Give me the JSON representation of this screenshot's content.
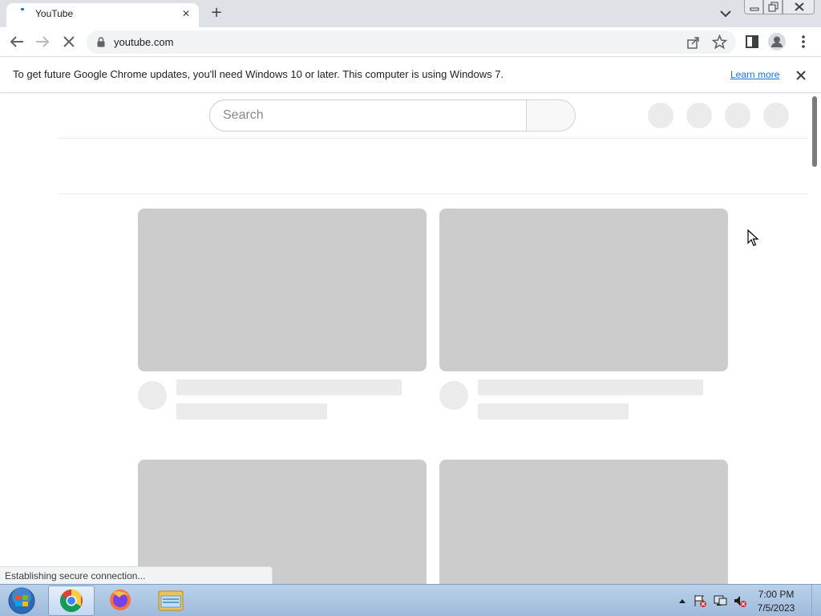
{
  "browser": {
    "tab_title": "YouTube",
    "address": "youtube.com",
    "colors": {
      "tab_strip": "#dee1e6",
      "omnibox": "#f1f3f4",
      "link": "#1a73e8"
    }
  },
  "infobar": {
    "message": "To get future Google Chrome updates, you'll need Windows 10 or later. This computer is using Windows 7.",
    "link_label": "Learn more"
  },
  "page": {
    "search_placeholder": "Search",
    "skeleton_color": "#cccccc",
    "skeleton_light_color": "#ebebeb"
  },
  "status": {
    "text": "Establishing secure connection..."
  },
  "taskbar": {
    "time": "7:00 PM",
    "date": "7/5/2023",
    "apps": [
      "chrome-icon",
      "firefox-icon",
      "file-explorer-icon"
    ]
  }
}
